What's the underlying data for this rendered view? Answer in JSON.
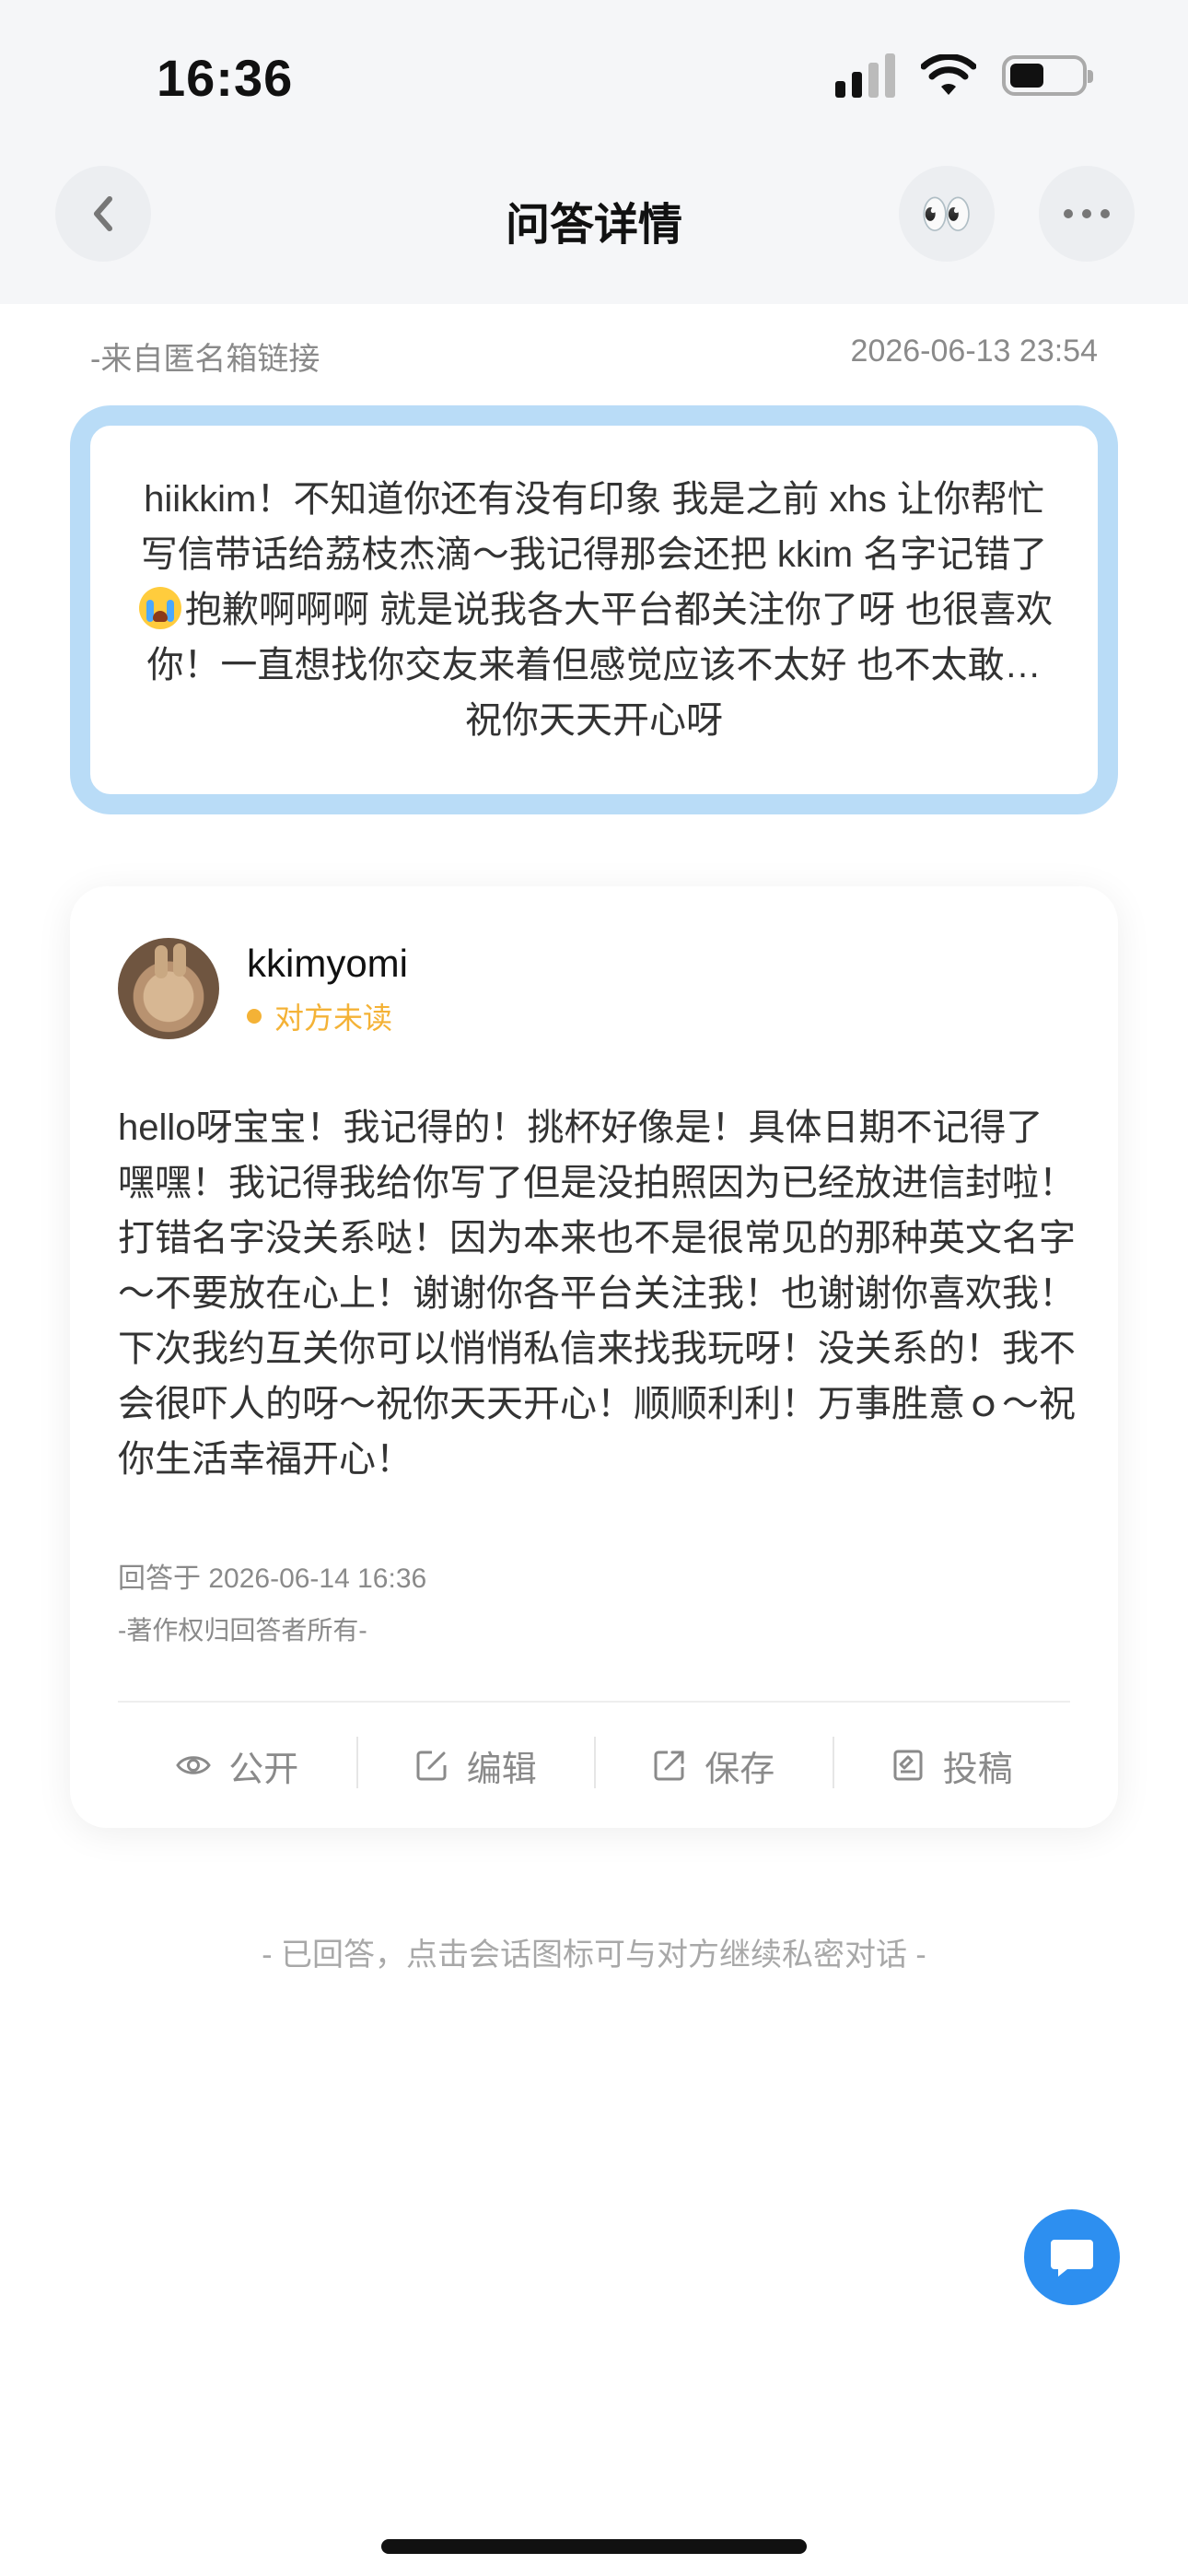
{
  "status_bar": {
    "time": "16:36"
  },
  "nav": {
    "title": "问答详情",
    "eyes_emoji": "👀"
  },
  "question": {
    "source": "-来自匿名箱链接",
    "date": "2026-06-13 23:54",
    "text_part1": "hiikkim！不知道你还有没有印象 我是之前 xhs 让你帮忙写信带话给荔枝杰滴～我记得那会还把 kkim 名字记错了",
    "emoji_name": "crying-face",
    "text_part2": "抱歉啊啊啊 就是说我各大平台都关注你了呀 也很喜欢你！一直想找你交友来着但感觉应该不太好 也不太敢…祝你天天开心呀"
  },
  "answer": {
    "username": "kkimyomi",
    "read_status": "对方未读",
    "text": "hello呀宝宝！我记得的！挑杯好像是！具体日期不记得了嘿嘿！我记得我给你写了但是没拍照因为已经放进信封啦！打错名字没关系哒！因为本来也不是很常见的那种英文名字～不要放在心上！谢谢你各平台关注我！也谢谢你喜欢我！下次我约互关你可以悄悄私信来找我玩呀！没关系的！我不会很吓人的呀～祝你天天开心！顺顺利利！万事胜意ｏ～祝你生活幸福开心！",
    "time": "回答于 2026-06-14 16:36",
    "copyright": "-著作权归回答者所有-",
    "actions": [
      {
        "label": "公开",
        "icon": "eye-icon"
      },
      {
        "label": "编辑",
        "icon": "edit-icon"
      },
      {
        "label": "保存",
        "icon": "save-icon"
      },
      {
        "label": "投稿",
        "icon": "submit-icon"
      }
    ]
  },
  "footer_note": "- 已回答，点击会话图标可与对方继续私密对话 -",
  "colors": {
    "accent_blue": "#2d8ff0",
    "question_border": "#b9dcf7",
    "unread_orange": "#f4b236"
  }
}
